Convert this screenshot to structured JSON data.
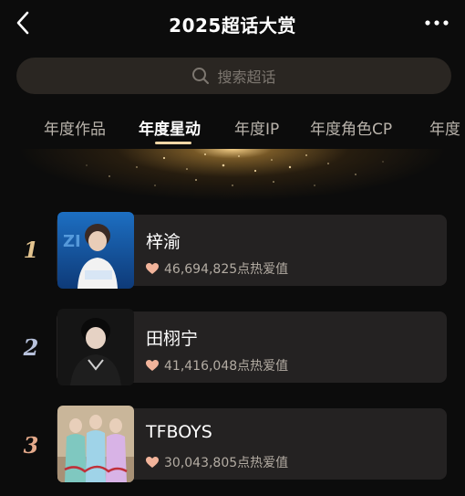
{
  "header": {
    "title": "2025超话大赏",
    "back_icon": "chevron-left-icon",
    "more_icon": "more-dots-icon"
  },
  "search": {
    "placeholder": "搜索超话",
    "icon": "search-icon"
  },
  "tabs": [
    {
      "label": "年度作品",
      "active": false
    },
    {
      "label": "年度星动",
      "active": true
    },
    {
      "label": "年度IP",
      "active": false
    },
    {
      "label": "年度角色CP",
      "active": false
    },
    {
      "label": "年度",
      "active": false
    }
  ],
  "rankings": [
    {
      "rank": "1",
      "name": "梓渝",
      "heat": "46,694,825点热爱值",
      "rank_color": "#e3c48f"
    },
    {
      "rank": "2",
      "name": "田栩宁",
      "heat": "41,416,048点热爱值",
      "rank_color": "#b8c2dc"
    },
    {
      "rank": "3",
      "name": "TFBOYS",
      "heat": "30,043,805点热爱值",
      "rank_color": "#e4a98a"
    }
  ],
  "colors": {
    "accent": "#f0d6a6",
    "heart": "#f2b49b",
    "card_bg": "#242222",
    "search_bg": "#2a2622"
  }
}
